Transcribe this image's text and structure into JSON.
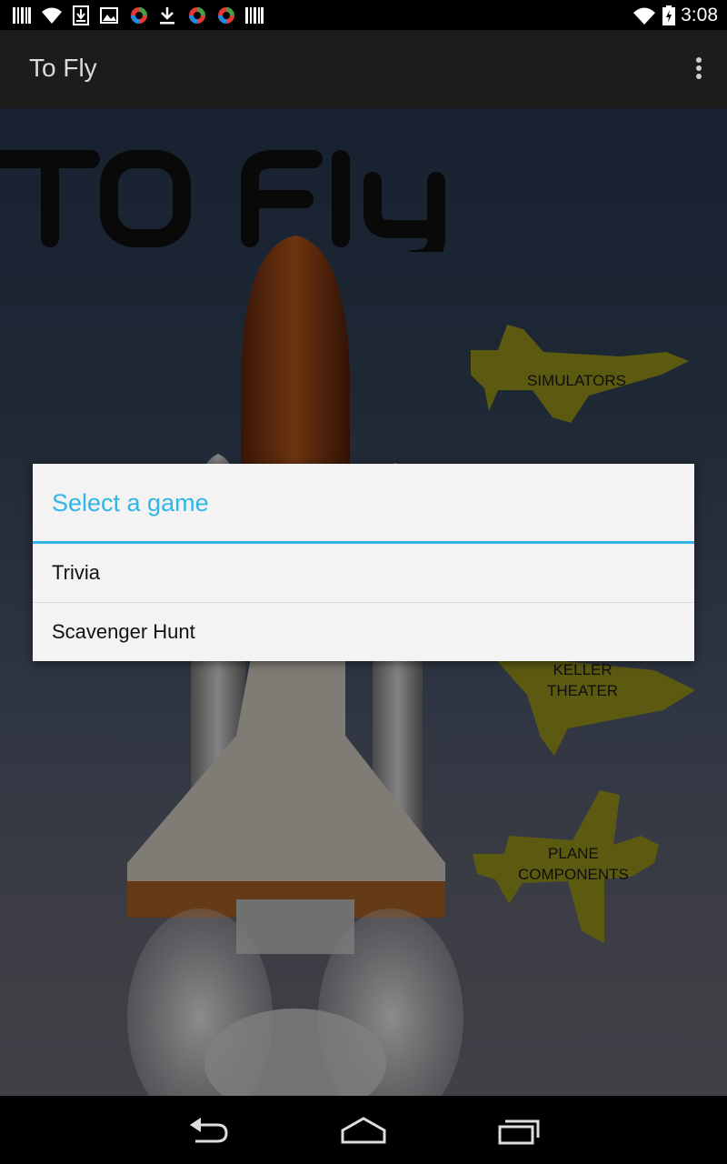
{
  "status_bar": {
    "time": "3:08",
    "left_icons": [
      "barcode-icon",
      "wifi-lock-icon",
      "download-box-icon",
      "image-icon",
      "colorful-app-icon",
      "download-icon",
      "colorful-app-icon",
      "colorful-app-icon",
      "barcode-icon"
    ],
    "right_icons": [
      "wifi-icon",
      "battery-charging-icon"
    ]
  },
  "action_bar": {
    "title": "To Fly",
    "overflow_icon": "overflow-menu-icon"
  },
  "content": {
    "logo_text": "TO FLY",
    "buttons": [
      {
        "label_lines": [
          "SIMULATORS"
        ]
      },
      {
        "label_lines": [
          "KELLER",
          "THEATER"
        ]
      },
      {
        "label_lines": [
          "PLANE",
          "COMPONENTS"
        ]
      }
    ],
    "accent_color": "#a8a41f"
  },
  "dialog": {
    "title": "Select a game",
    "items": [
      "Trivia",
      "Scavenger Hunt"
    ],
    "accent_color": "#33b5e5"
  },
  "nav_bar": {
    "icons": [
      "back-icon",
      "home-icon",
      "recent-apps-icon"
    ]
  }
}
